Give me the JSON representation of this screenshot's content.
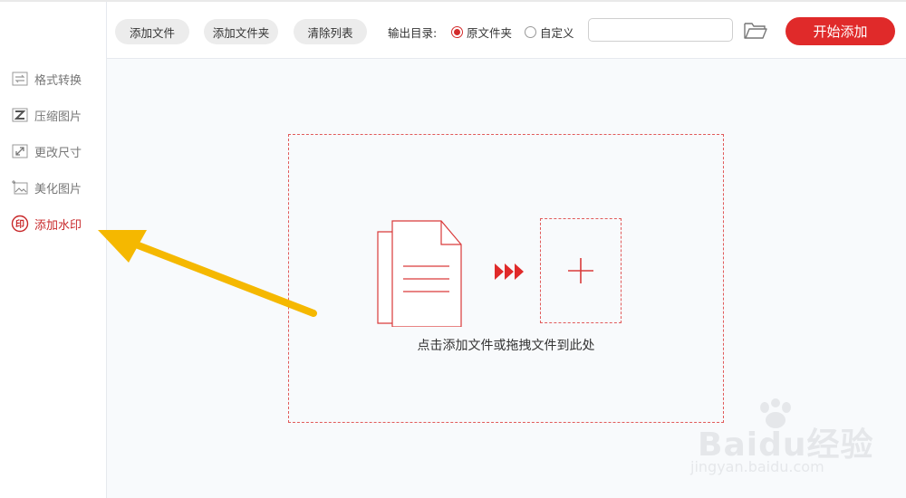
{
  "sidebar": {
    "items": [
      {
        "label": "格式转换",
        "icon": "convert-icon"
      },
      {
        "label": "压缩图片",
        "icon": "compress-icon"
      },
      {
        "label": "更改尺寸",
        "icon": "resize-icon"
      },
      {
        "label": "美化图片",
        "icon": "beautify-icon"
      },
      {
        "label": "添加水印",
        "icon": "watermark-seal-icon",
        "active": true
      }
    ]
  },
  "toolbar": {
    "add_file": "添加文件",
    "add_folder": "添加文件夹",
    "clear_list": "清除列表",
    "output_label": "输出目录:",
    "radio_original": "原文件夹",
    "radio_custom": "自定义",
    "path_value": "",
    "start_button": "开始添加"
  },
  "main": {
    "drop_text": "点击添加文件或拖拽文件到此处"
  },
  "watermark": {
    "brand": "Baidu经验",
    "url": "jingyan.baidu.com"
  },
  "colors": {
    "accent": "#e02a2a",
    "active_text": "#c8282a",
    "arrow": "#f5b800"
  }
}
